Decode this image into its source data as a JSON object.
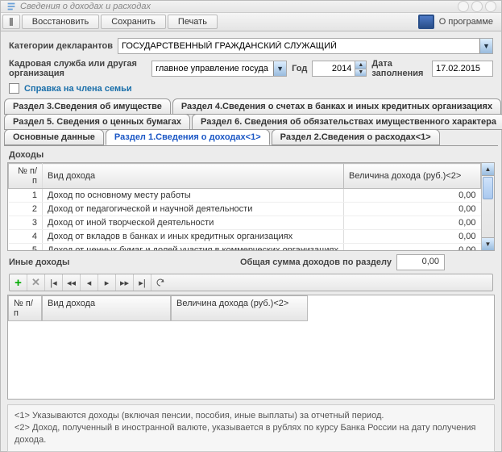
{
  "window": {
    "title": "Сведения о доходах и расходах"
  },
  "toolbar": {
    "restore": "Восстановить",
    "save": "Сохранить",
    "print": "Печать",
    "about": "О программе"
  },
  "header": {
    "category_label": "Категории декларантов",
    "category_value": "ГОСУДАРСТВЕННЫЙ ГРАЖДАНСКИЙ СЛУЖАЩИЙ",
    "org_label": "Кадровая служба или другая организация",
    "org_value": "главное управление госуда",
    "year_label": "Год",
    "year_value": "2014",
    "fill_date_label": "Дата заполнения",
    "fill_date_value": "17.02.2015",
    "family_check_label": "Справка на члена семьи"
  },
  "tabs": {
    "r3": "Раздел 3.Сведения об имуществе",
    "r4": "Раздел 4.Сведения о счетах в банках и иных кредитных организациях",
    "r5": "Раздел 5. Сведения о ценных бумагах",
    "r6": "Раздел 6. Сведения об обязательствах имущественного характера",
    "main": "Основные данные",
    "r1": "Раздел 1.Сведения о доходах<1>",
    "r2": "Раздел 2.Сведения о расходах<1>"
  },
  "section1": {
    "title": "Доходы",
    "col_num": "№ п/п",
    "col_kind": "Вид дохода",
    "col_value": "Величина дохода (руб.)<2>",
    "rows": [
      {
        "n": "1",
        "kind": "Доход по основному месту работы",
        "val": "0,00"
      },
      {
        "n": "2",
        "kind": "Доход от педагогической и научной деятельности",
        "val": "0,00"
      },
      {
        "n": "3",
        "kind": "Доход от иной творческой деятельности",
        "val": "0,00"
      },
      {
        "n": "4",
        "kind": "Доход от вкладов в банках и иных кредитных организациях",
        "val": "0,00"
      },
      {
        "n": "5",
        "kind": "Доход от ценных бумаг и долей участия в коммерческих организациях",
        "val": "0,00"
      }
    ]
  },
  "section2": {
    "title": "Иные доходы",
    "total_label": "Общая сумма  доходов по разделу",
    "total_value": "0,00",
    "col_num": "№ п/п",
    "col_kind": "Вид дохода",
    "col_value": "Величина дохода (руб.)<2>"
  },
  "footnotes": {
    "f1": "<1> Указываются доходы (включая пенсии, пособия, иные выплаты) за отчетный период.",
    "f2": "<2> Доход, полученный в иностранной валюте, указывается в рублях по курсу Банка России на дату получения дохода."
  }
}
